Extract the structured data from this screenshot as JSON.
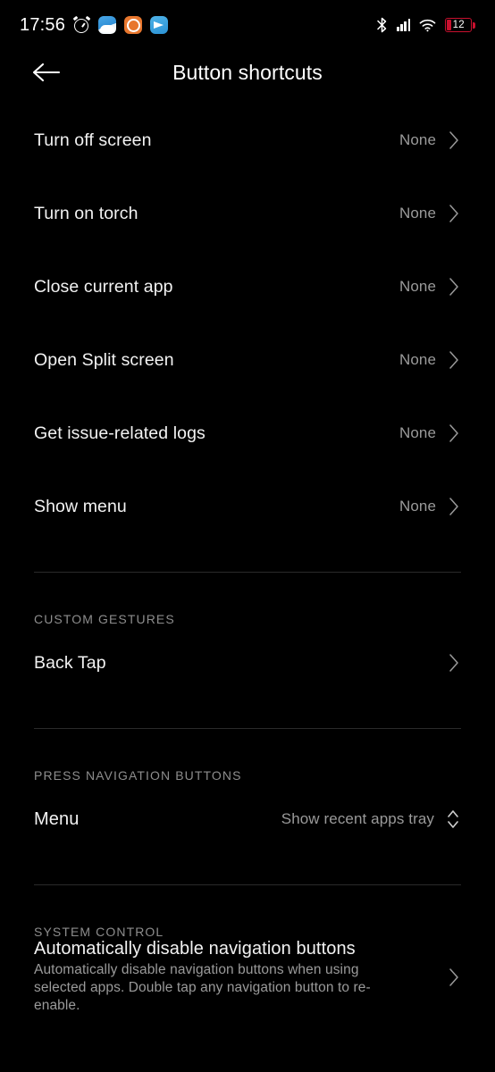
{
  "status_bar": {
    "time": "17:56",
    "alarm_icon": "alarm-clock-icon",
    "notification_icons": [
      "weather-app-icon",
      "orange-app-icon",
      "telegram-app-icon"
    ],
    "bluetooth_icon": "bluetooth-icon",
    "signal_icon": "cellular-signal-icon",
    "wifi_icon": "wifi-icon",
    "battery_level": "12",
    "battery_color": "#c8102e"
  },
  "app_bar": {
    "back_icon": "back-arrow-icon",
    "title": "Button shortcuts"
  },
  "shortcut_rows": [
    {
      "title": "Turn off screen",
      "value": "None"
    },
    {
      "title": "Turn on torch",
      "value": "None"
    },
    {
      "title": "Close current app",
      "value": "None"
    },
    {
      "title": "Open Split screen",
      "value": "None"
    },
    {
      "title": "Get issue-related logs",
      "value": "None"
    },
    {
      "title": "Show menu",
      "value": "None"
    }
  ],
  "sections": {
    "custom_gestures": {
      "header": "CUSTOM GESTURES",
      "row": {
        "title": "Back Tap"
      }
    },
    "press_navigation_buttons": {
      "header": "PRESS NAVIGATION BUTTONS",
      "row": {
        "title": "Menu",
        "value": "Show recent apps tray"
      }
    },
    "system_control": {
      "header": "SYSTEM CONTROL",
      "row": {
        "title": "Automatically disable navigation buttons",
        "subtitle": "Automatically disable navigation buttons when using selected apps. Double tap any navigation button to re-enable."
      }
    }
  },
  "colors": {
    "background": "#000000",
    "primary_text": "#f2f2f2",
    "secondary_text": "#9a9a9a",
    "divider": "#2a2a2a"
  }
}
